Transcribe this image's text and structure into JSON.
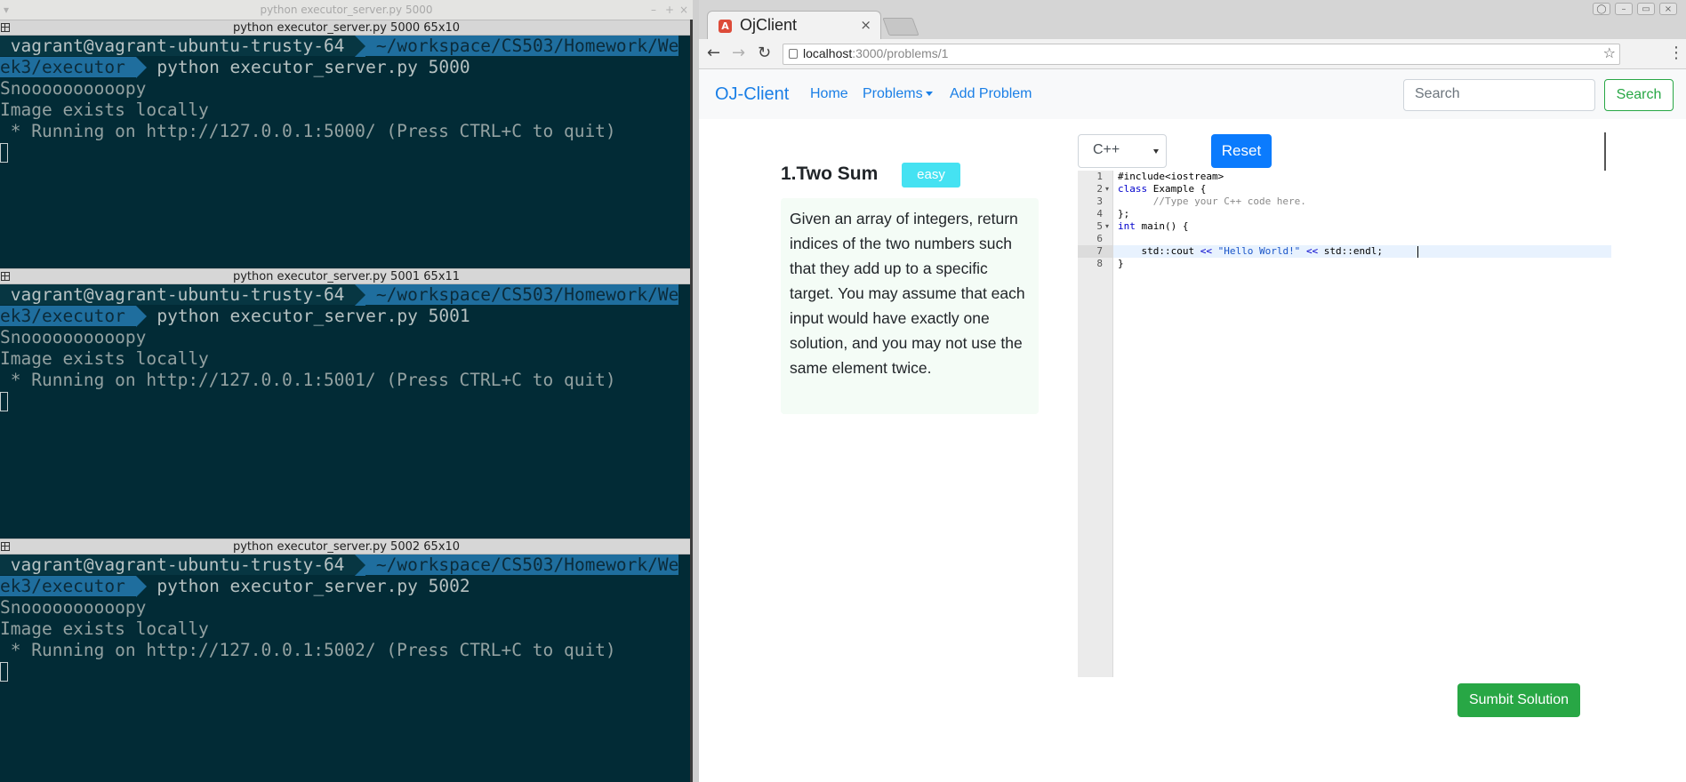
{
  "terminal": {
    "window_title": "python executor_server.py 5000",
    "prompt_user": " vagrant@vagrant-ubuntu-trusty-64 ",
    "prompt_path": " ~/workspace/CS503/Homework/We",
    "prompt_path_cont": "ek3/executor ",
    "panes": [
      {
        "header": "python executor_server.py 5000 65x10",
        "command": " python executor_server.py 5000",
        "output": [
          "Snoooooooooopy",
          "Image exists locally",
          " * Running on http://127.0.0.1:5000/ (Press CTRL+C to quit)"
        ]
      },
      {
        "header": "python executor_server.py 5001 65x11",
        "command": " python executor_server.py 5001",
        "output": [
          "Snoooooooooopy",
          "Image exists locally",
          " * Running on http://127.0.0.1:5001/ (Press CTRL+C to quit)"
        ]
      },
      {
        "header": "python executor_server.py 5002 65x10",
        "command": " python executor_server.py 5002",
        "output": [
          "Snoooooooooopy",
          "Image exists locally",
          " * Running on http://127.0.0.1:5002/ (Press CTRL+C to quit)"
        ]
      }
    ]
  },
  "browser": {
    "tab_title": "OjClient",
    "tab_close": "×",
    "url_host": "localhost",
    "url_path": ":3000/problems/1",
    "nav": {
      "back": "←",
      "forward": "→",
      "reload": "↻",
      "star": "☆",
      "menu": "⋮"
    }
  },
  "app": {
    "brand": "OJ-Client",
    "nav_links": [
      "Home",
      "Problems",
      "Add Problem"
    ],
    "search_placeholder": "Search",
    "search_button": "Search",
    "problem": {
      "title": "1.Two Sum",
      "difficulty": "easy",
      "description": "Given an array of integers, return indices of the two numbers such that they add up to a specific target. You may assume that each input would have exactly one solution, and you may not use the same element twice."
    },
    "language": "C++",
    "reset_button": "Reset",
    "submit_button": "Sumbit Solution",
    "code_lines": [
      "#include<iostream>",
      "class Example {",
      "      //Type your C++ code here.",
      "};",
      "int main() {",
      "",
      "    std::cout << \"Hello World!\" << std::endl; ",
      "}"
    ],
    "line_numbers": [
      "1",
      "2",
      "3",
      "4",
      "5",
      "6",
      "7",
      "8"
    ],
    "active_line": 7
  },
  "colors": {
    "terminal_bg": "#022b36",
    "link": "#1a7fe6",
    "reset": "#0b7bfd",
    "submit": "#28a745",
    "badge": "#45e2f2"
  }
}
